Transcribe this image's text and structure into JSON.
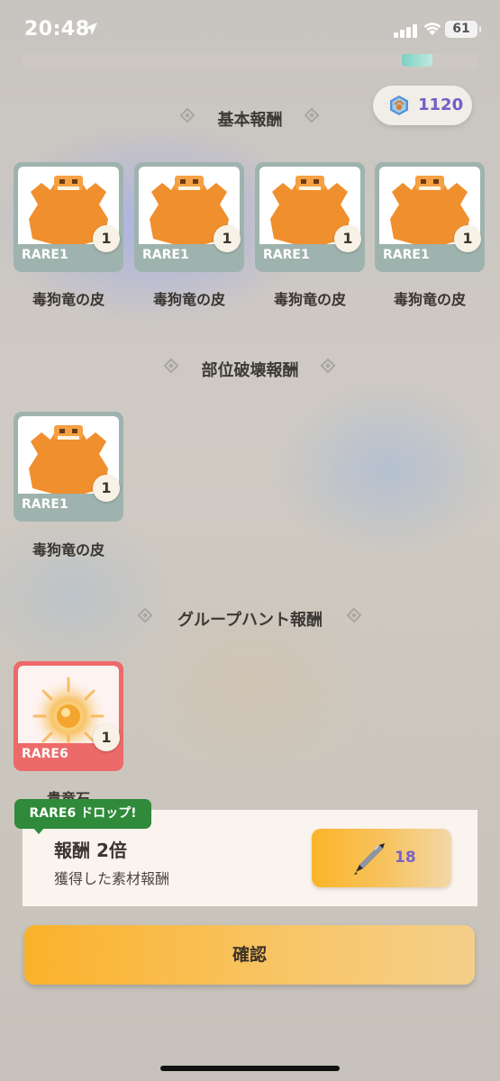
{
  "status_bar": {
    "time": "20:48",
    "battery": "61"
  },
  "currency": {
    "value": "1120",
    "icon": "paw-gem-icon"
  },
  "sections": {
    "basic": {
      "title": "基本報酬"
    },
    "part_break": {
      "title": "部位破壊報酬"
    },
    "group_hunt": {
      "title": "グループハント報酬"
    }
  },
  "basic_rewards": [
    {
      "name": "毒狗竜の皮",
      "rarity": "RARE1",
      "qty": "1"
    },
    {
      "name": "毒狗竜の皮",
      "rarity": "RARE1",
      "qty": "1"
    },
    {
      "name": "毒狗竜の皮",
      "rarity": "RARE1",
      "qty": "1"
    },
    {
      "name": "毒狗竜の皮",
      "rarity": "RARE1",
      "qty": "1"
    }
  ],
  "part_break_rewards": [
    {
      "name": "毒狗竜の皮",
      "rarity": "RARE1",
      "qty": "1"
    }
  ],
  "group_hunt_rewards": [
    {
      "name": "貴竜石",
      "rarity": "RARE6",
      "qty": "1"
    }
  ],
  "bonus": {
    "badge": "RARE6 ドロップ!",
    "title": "報酬 2倍",
    "subtitle": "獲得した素材報酬",
    "ticket_count": "18",
    "ticket_icon": "knife-ticket-icon"
  },
  "confirm_label": "確認",
  "colors": {
    "rare1": "#9fb3ae",
    "rare6": "#ed6a6a",
    "accent": "#fbb12a",
    "currency_text": "#6f5fc7",
    "badge_green": "#2f8a3a"
  }
}
